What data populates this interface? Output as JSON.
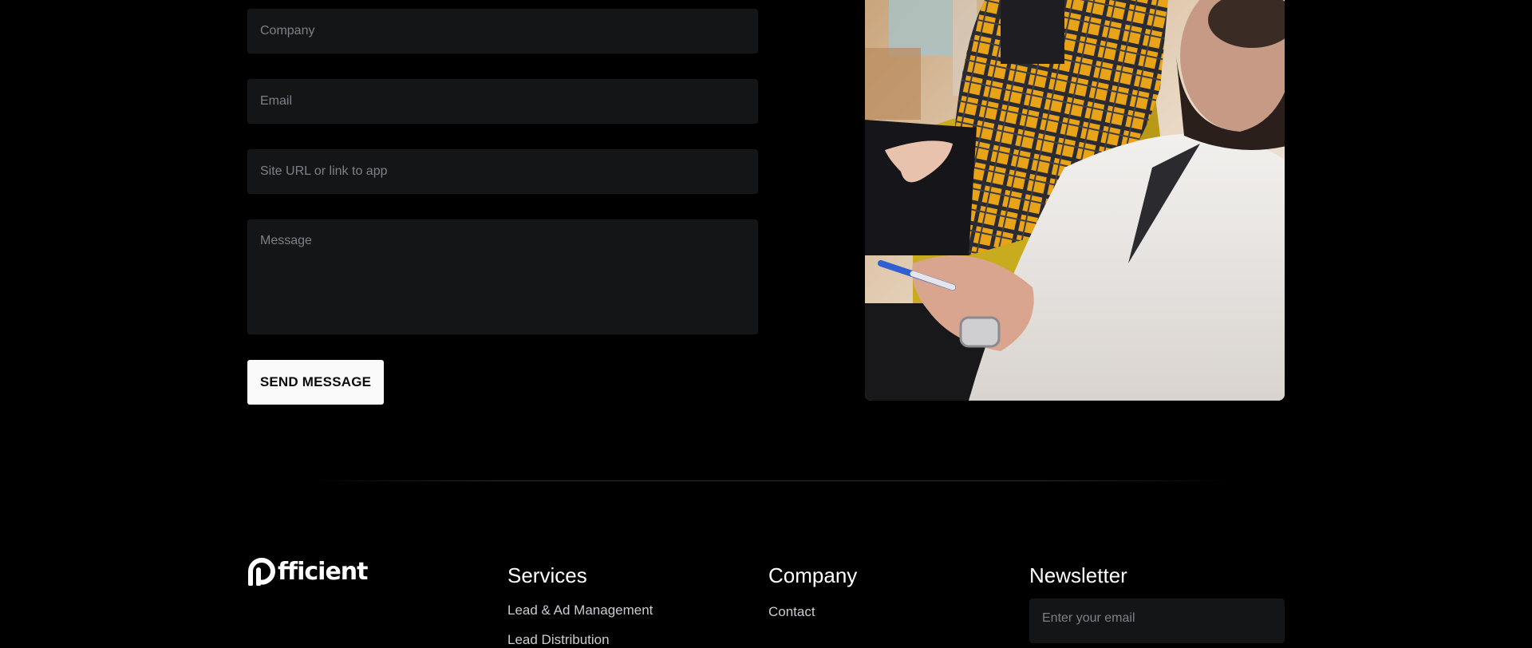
{
  "contact_form": {
    "company_placeholder": "Company",
    "email_placeholder": "Email",
    "site_placeholder": "Site URL or link to app",
    "message_placeholder": "Message",
    "send_label": "SEND MESSAGE"
  },
  "footer": {
    "logo_text": "fficient",
    "services": {
      "title": "Services",
      "links": [
        "Lead & Ad Management",
        "Lead Distribution"
      ]
    },
    "company": {
      "title": "Company",
      "links": [
        "Contact"
      ]
    },
    "newsletter": {
      "title": "Newsletter",
      "placeholder": "Enter your email"
    }
  },
  "colors": {
    "background": "#000000",
    "field": "#141517",
    "button": "#fafafa",
    "link": "#c9ccd3"
  }
}
